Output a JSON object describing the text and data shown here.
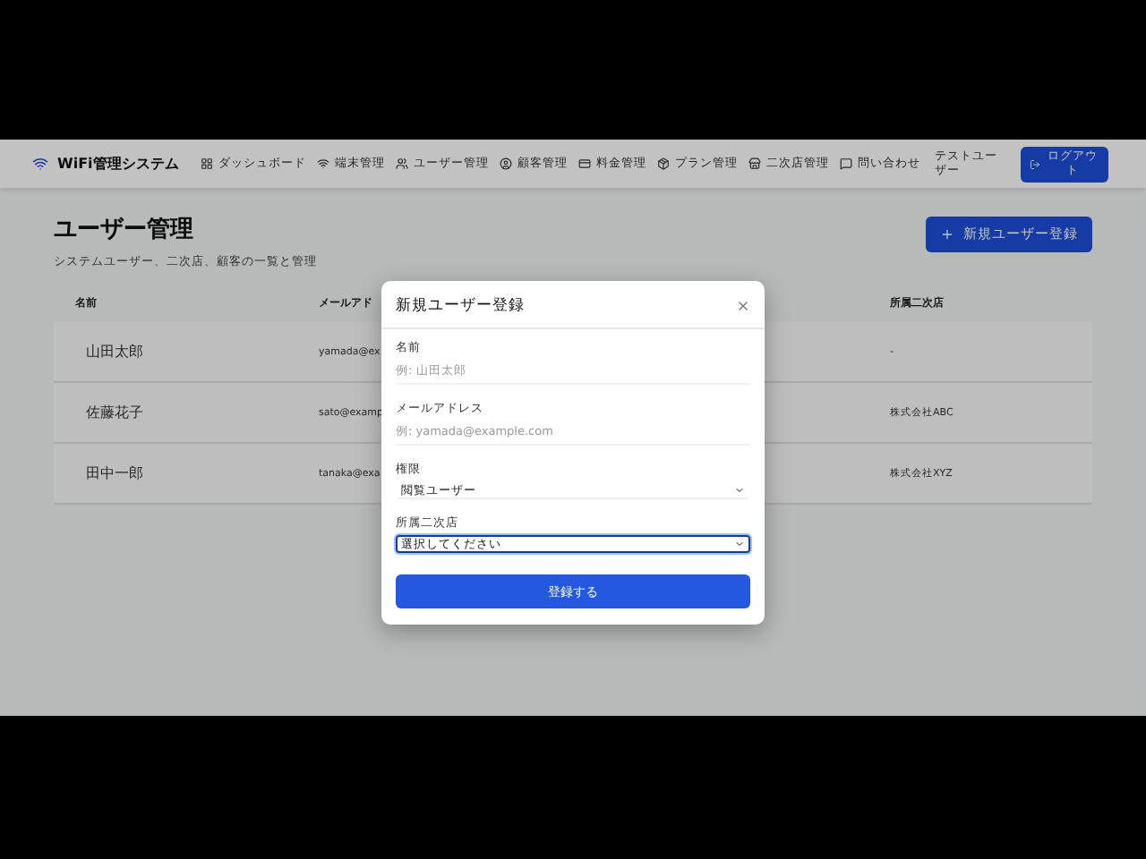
{
  "header": {
    "brand": "WiFi管理システム",
    "nav": [
      {
        "label": "ダッシュボード"
      },
      {
        "label": "端末管理"
      },
      {
        "label": "ユーザー管理"
      },
      {
        "label": "顧客管理"
      },
      {
        "label": "料金管理"
      },
      {
        "label": "プラン管理"
      },
      {
        "label": "二次店管理"
      },
      {
        "label": "問い合わせ"
      }
    ],
    "user": "テストユーザー",
    "logout": "ログアウト"
  },
  "page": {
    "title": "ユーザー管理",
    "subtitle": "システムユーザー、二次店、顧客の一覧と管理",
    "add_button": "新規ユーザー登録"
  },
  "table": {
    "columns": [
      "名前",
      "メールアド",
      "所属二次店"
    ],
    "rows": [
      [
        "山田太郎",
        "yamada@ex",
        "-"
      ],
      [
        "佐藤花子",
        "sato@examp",
        "株式会社ABC"
      ],
      [
        "田中一郎",
        "tanaka@exa",
        "株式会社XYZ"
      ]
    ]
  },
  "modal": {
    "title": "新規ユーザー登録",
    "fields": [
      {
        "kind": "text",
        "label": "名前",
        "placeholder": "例: 山田太郎",
        "focused": false
      },
      {
        "kind": "text",
        "label": "メールアドレス",
        "placeholder": "例: yamada@example.com",
        "focused": false
      },
      {
        "kind": "select",
        "label": "権限",
        "value": "閲覧ユーザー",
        "focused": false
      },
      {
        "kind": "select",
        "label": "所属二次店",
        "value": "選択してください",
        "focused": true
      }
    ],
    "submit": "登録する"
  }
}
